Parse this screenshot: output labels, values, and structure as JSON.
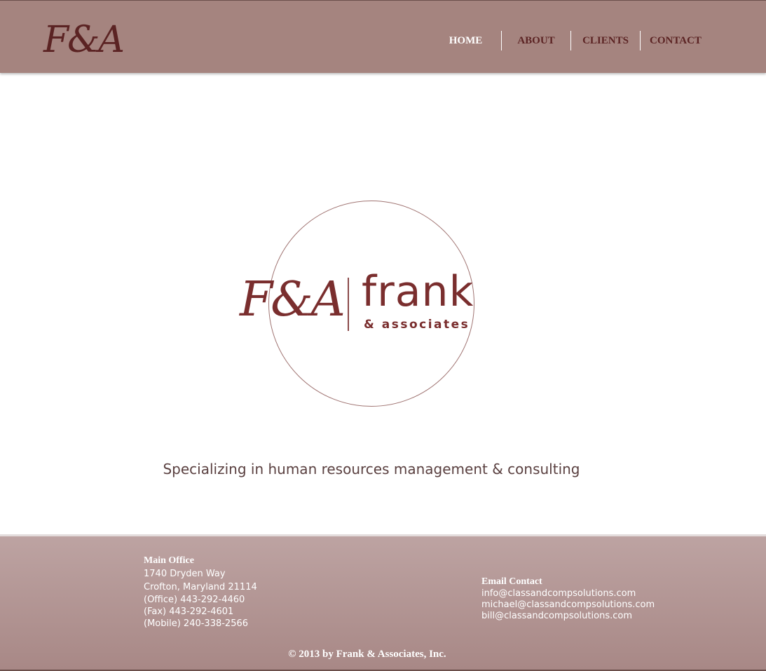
{
  "header": {
    "logo_text": "F&A",
    "nav": [
      {
        "label": "HOME",
        "active": true
      },
      {
        "label": "ABOUT",
        "active": false
      },
      {
        "label": "CLIENTS",
        "active": false
      },
      {
        "label": "CONTACT",
        "active": false
      }
    ]
  },
  "hero": {
    "monogram": "F&A",
    "brand_name": "frank",
    "brand_sub": "& associates"
  },
  "tagline": "Specializing in human resources management & consulting",
  "footer": {
    "main_office": {
      "heading": "Main Office",
      "lines": [
        "1740 Dryden Way",
        "Crofton, Maryland 21114",
        "(Office) 443-292-4460",
        "(Fax) 443-292-4601",
        "(Mobile) 240-338-2566"
      ]
    },
    "email_contact": {
      "heading": "Email Contact",
      "emails": [
        "info@classandcompsolutions.com",
        "michael@classandcompsolutions.com",
        "bill@classandcompsolutions.com"
      ]
    },
    "copyright": "© 2013 by Frank & Associates, Inc."
  },
  "colors": {
    "header_bg": "#a5847f",
    "brand_maroon": "#7a2e2e",
    "footer_bg": "#b39594",
    "nav_active": "#ffffff"
  }
}
